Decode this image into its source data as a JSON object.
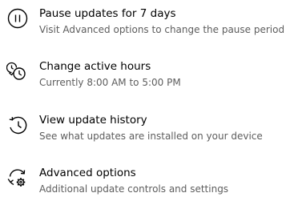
{
  "items": [
    {
      "icon": "pause-circle-icon",
      "title": "Pause updates for 7 days",
      "subtitle": "Visit Advanced options to change the pause period"
    },
    {
      "icon": "active-hours-clock-icon",
      "title": "Change active hours",
      "subtitle": "Currently 8:00 AM to 5:00 PM"
    },
    {
      "icon": "history-icon",
      "title": "View update history",
      "subtitle": "See what updates are installed on your device"
    },
    {
      "icon": "sync-gear-icon",
      "title": "Advanced options",
      "subtitle": "Additional update controls and settings"
    }
  ]
}
